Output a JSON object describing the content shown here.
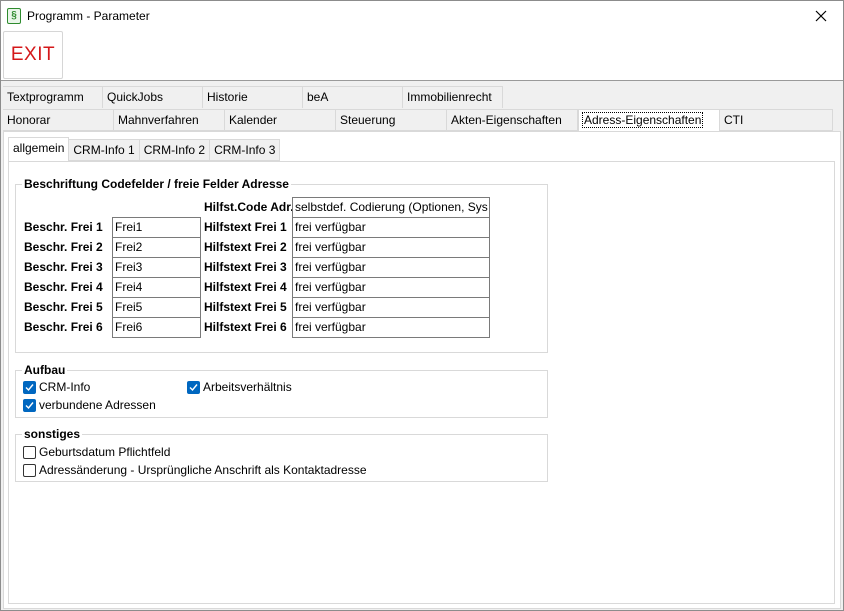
{
  "window": {
    "title": "Programm - Parameter",
    "app_icon_glyph": "§",
    "accent_color": "#0067c0"
  },
  "toolbar": {
    "exit_label": "EXIT",
    "exit_color": "#d4181a"
  },
  "tabs_row1": [
    "Textprogramm",
    "QuickJobs",
    "Historie",
    "beA",
    "Immobilienrecht"
  ],
  "tabs_row2": [
    "Honorar",
    "Mahnverfahren",
    "Kalender",
    "Steuerung",
    "Akten-Eigenschaften",
    "Adress-Eigenschaften",
    "CTI"
  ],
  "active_main_tab": "Adress-Eigenschaften",
  "subtabs": [
    "allgemein",
    "CRM-Info 1",
    "CRM-Info 2",
    "CRM-Info 3"
  ],
  "active_subtab": "allgemein",
  "codefields": {
    "title": "Beschriftung Codefelder / freie Felder Adresse",
    "hilfst_code_label": "Hilfst.Code Adr.",
    "hilfst_code_value": "selbstdef. Codierung (Optionen, Sys",
    "rows": [
      {
        "label": "Beschr. Frei 1",
        "value": "Frei1",
        "help_label": "Hilfstext Frei 1",
        "help_value": "frei verfügbar"
      },
      {
        "label": "Beschr. Frei 2",
        "value": "Frei2",
        "help_label": "Hilfstext Frei 2",
        "help_value": "frei verfügbar"
      },
      {
        "label": "Beschr. Frei 3",
        "value": "Frei3",
        "help_label": "Hilfstext Frei 3",
        "help_value": "frei verfügbar"
      },
      {
        "label": "Beschr. Frei 4",
        "value": "Frei4",
        "help_label": "Hilfstext Frei 4",
        "help_value": "frei verfügbar"
      },
      {
        "label": "Beschr. Frei 5",
        "value": "Frei5",
        "help_label": "Hilfstext Frei 5",
        "help_value": "frei verfügbar"
      },
      {
        "label": "Beschr. Frei 6",
        "value": "Frei6",
        "help_label": "Hilfstext Frei 6",
        "help_value": "frei verfügbar"
      }
    ]
  },
  "aufbau": {
    "title": "Aufbau",
    "items": [
      {
        "label": "CRM-Info",
        "checked": true
      },
      {
        "label": "Arbeitsverhältnis",
        "checked": true
      },
      {
        "label": "verbundene Adressen",
        "checked": true
      }
    ]
  },
  "sonstiges": {
    "title": "sonstiges",
    "items": [
      {
        "label": "Geburtsdatum Pflichtfeld",
        "checked": false
      },
      {
        "label": "Adressänderung - Ursprüngliche Anschrift als Kontaktadresse",
        "checked": false
      }
    ]
  }
}
